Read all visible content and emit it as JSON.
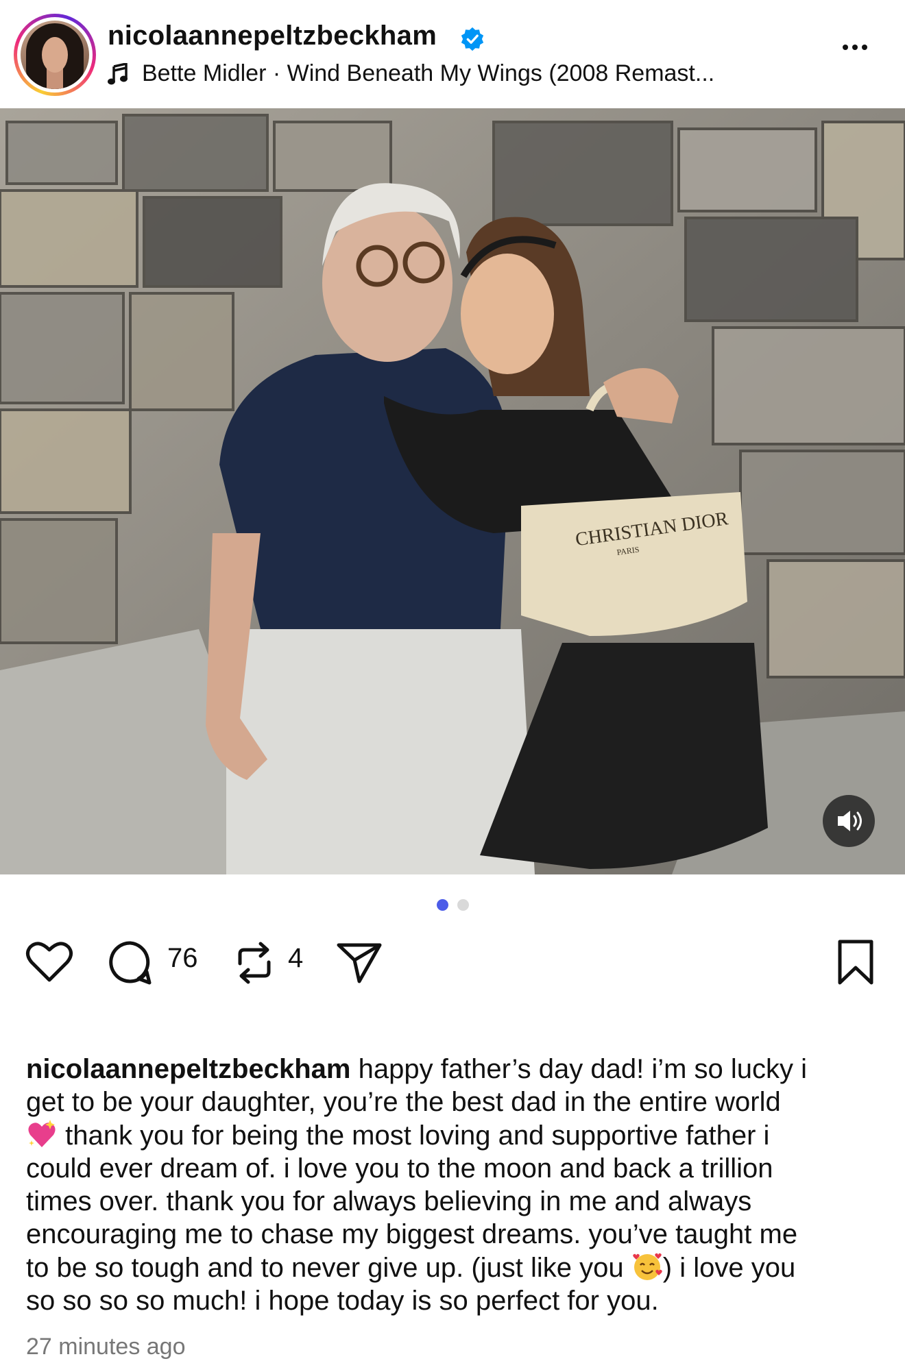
{
  "post": {
    "username": "nicolaannepeltzbeckham",
    "verified": true,
    "music": "Bette Midler · Wind Beneath My Wings (2008 Remast...",
    "more_icon": "ellipsis-icon",
    "photo_text": "CHRISTIAN DIOR",
    "photo_subtext": "PARIS",
    "carousel": {
      "total": 2,
      "active": 1,
      "active_color": "#4c5ce8",
      "inactive_color": "#d9d9d9"
    }
  },
  "actions": {
    "comments": "76",
    "reposts": "4",
    "icons": [
      "heart-icon",
      "comment-icon",
      "repost-icon",
      "share-icon",
      "bookmark-icon"
    ]
  },
  "caption": {
    "username": "nicolaannepeltzbeckham",
    "lines": [
      " happy father’s day dad! i’m so lucky i",
      "get to be your daughter, you’re the best dad in the entire world",
      " thank you for being the most loving and supportive father i",
      "could ever dream of. i love you to the moon and back a trillion",
      "times over. thank you for always believing in me and always",
      "encouraging me to chase my biggest dreams. you’ve taught me",
      "to be so tough and to never give up. (just like you ",
      ") i love you",
      "so so so so much! i hope today is so perfect for you."
    ],
    "emojis": [
      "sparkling-heart-emoji",
      "smiling-face-with-hearts-emoji"
    ]
  },
  "timestamp": "27 minutes ago"
}
